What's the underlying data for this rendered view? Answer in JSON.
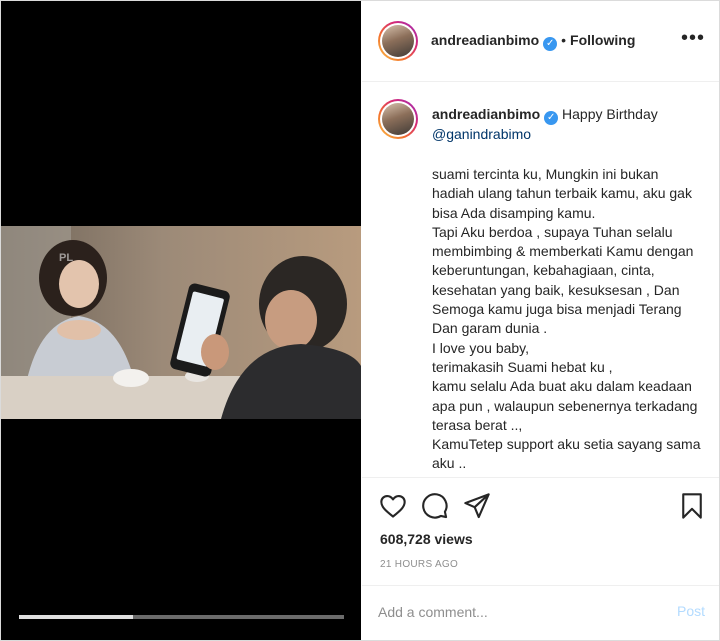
{
  "post": {
    "username": "andreadianbimo",
    "verified_glyph": "✓",
    "separator": "•",
    "follow_status": "Following",
    "more_glyph": "•••"
  },
  "caption": {
    "username": "andreadianbimo",
    "opening": "Happy Birthday",
    "mention": "@ganindrabimo",
    "body": "suami tercinta ku, Mungkin ini bukan hadiah ulang tahun terbaik kamu, aku gak bisa Ada disamping kamu.\nTapi Aku berdoa , supaya Tuhan selalu membimbing & memberkati Kamu dengan keberuntungan, kebahagiaan, cinta, kesehatan yang baik, kesuksesan , Dan Semoga kamu juga bisa menjadi Terang Dan garam dunia .\nI love you baby,\nterimakasih Suami hebat ku ,\nkamu selalu Ada buat aku dalam keadaan apa pun , walaupun sebenernya terkadang terasa berat ..,\nKamuTetep support aku setia sayang sama aku ..\nSelamat ulang tahun sayang ku, aku sayang kamu"
  },
  "media": {
    "watermark": "PL",
    "progress_fraction": 0.35
  },
  "stats": {
    "views": "608,728 views",
    "time_ago": "21 HOURS AGO"
  },
  "comment": {
    "placeholder": "Add a comment...",
    "post_label": "Post"
  },
  "icons": {
    "like": "heart-icon",
    "comment": "comment-icon",
    "share": "share-icon",
    "save": "bookmark-icon"
  },
  "colors": {
    "verified": "#3897f0",
    "mention": "#003569",
    "post_disabled": "#b3dbff",
    "muted": "#8e8e8e"
  }
}
